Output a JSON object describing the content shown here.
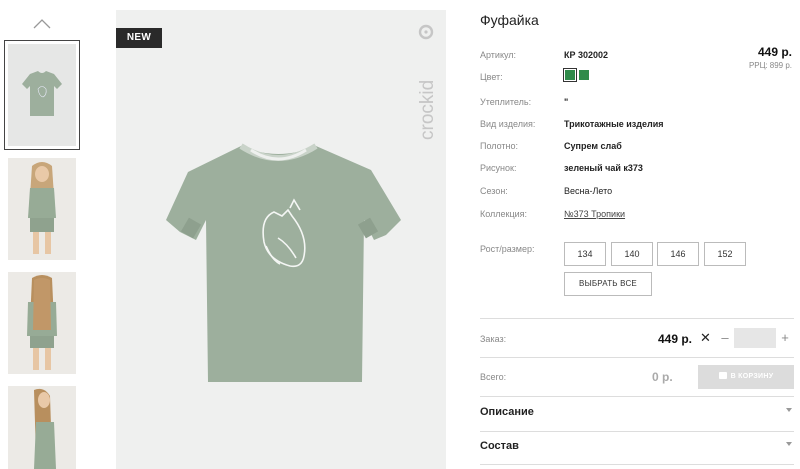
{
  "gallery": {
    "thumbnails": [
      {
        "alt": "t-shirt front"
      },
      {
        "alt": "model front"
      },
      {
        "alt": "model back"
      },
      {
        "alt": "model side"
      }
    ]
  },
  "main_image": {
    "badge": "NEW",
    "brand": "crockid"
  },
  "product": {
    "title": "Фуфайка",
    "price": "449 р.",
    "rrp_label": "РРЦ:",
    "rrp_value": "899 р.",
    "attributes": [
      {
        "label": "Артикул:",
        "value": "КР 302002"
      },
      {
        "label": "Цвет:",
        "value": ""
      },
      {
        "label": "Утеплитель:",
        "value": "\""
      },
      {
        "label": "Вид изделия:",
        "value": "Трикотажные изделия"
      },
      {
        "label": "Полотно:",
        "value": "Супрем слаб"
      },
      {
        "label": "Рисунок:",
        "value": "зеленый чай к373"
      },
      {
        "label": "Сезон:",
        "value": "Весна-Лето"
      },
      {
        "label": "Коллекция:",
        "value": "№373 Тропики"
      }
    ],
    "color_swatches": [
      "#2f8b4a",
      "#2f8b4a"
    ],
    "size_label": "Рост/размер:",
    "sizes": [
      "134",
      "140",
      "146",
      "152"
    ],
    "select_all": "ВЫБРАТЬ ВСЕ"
  },
  "order": {
    "label": "Заказ:",
    "price": "449 р.",
    "times": "✕",
    "minus": "–",
    "plus": "+",
    "qty": ""
  },
  "total": {
    "label": "Всего:",
    "value": "0 р.",
    "cart_button": "В КОРЗИНУ"
  },
  "accordion": [
    {
      "title": "Описание"
    },
    {
      "title": "Состав"
    }
  ]
}
